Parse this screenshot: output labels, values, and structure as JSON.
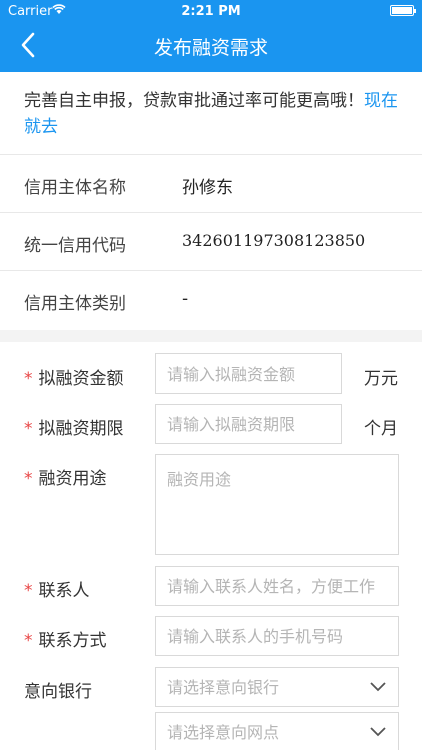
{
  "status_bar": {
    "carrier": "Carrier",
    "time": "2:21 PM"
  },
  "nav": {
    "title": "发布融资需求"
  },
  "tip": {
    "text": "完善自主申报，贷款审批通过率可能更高哦！",
    "link": "现在就去"
  },
  "info": [
    {
      "label": "信用主体名称",
      "value": "孙修东"
    },
    {
      "label": "统一信用代码",
      "value": "342601197308123850"
    },
    {
      "label": "信用主体类别",
      "value": "-"
    }
  ],
  "form": {
    "required_mark": "*",
    "amount": {
      "label": "拟融资金额",
      "placeholder": "请输入拟融资金额",
      "unit": "万元"
    },
    "term": {
      "label": "拟融资期限",
      "placeholder": "请输入拟融资期限",
      "unit": "个月"
    },
    "purpose": {
      "label": "融资用途",
      "placeholder": "融资用途"
    },
    "contact": {
      "label": "联系人",
      "placeholder": "请输入联系人姓名，方便工作"
    },
    "phone": {
      "label": "联系方式",
      "placeholder": "请输入联系人的手机号码"
    },
    "bank": {
      "label": "意向银行",
      "placeholder": "请选择意向银行"
    },
    "branch": {
      "placeholder": "请选择意向网点"
    }
  },
  "colors": {
    "primary": "#1a95f0",
    "required": "#e84545"
  }
}
